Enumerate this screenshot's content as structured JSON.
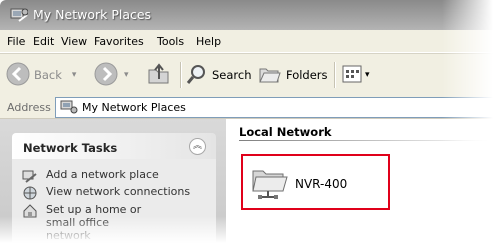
{
  "window": {
    "title": "My Network Places"
  },
  "menu": [
    "File",
    "Edit",
    "View",
    "Favorites",
    "Tools",
    "Help"
  ],
  "toolbar": {
    "back_label": "Back",
    "search_label": "Search",
    "folders_label": "Folders",
    "icons": [
      "back-arrow-icon",
      "forward-arrow-icon",
      "up-folder-icon",
      "search-icon",
      "folders-icon",
      "views-icon"
    ]
  },
  "address": {
    "label": "Address",
    "value": "My Network Places"
  },
  "tasks": {
    "header": "Network Tasks",
    "items": [
      {
        "label": "Add a network place",
        "icon": "add-network-place-icon"
      },
      {
        "label": "View network connections",
        "icon": "network-connections-icon"
      },
      {
        "label": "Set up a home or small office network",
        "icon": "home-network-icon"
      }
    ]
  },
  "content": {
    "section_title": "Local Network",
    "items": [
      {
        "label": "NVR-400",
        "icon": "network-folder-icon"
      }
    ],
    "highlight_color": "#e0001a"
  }
}
